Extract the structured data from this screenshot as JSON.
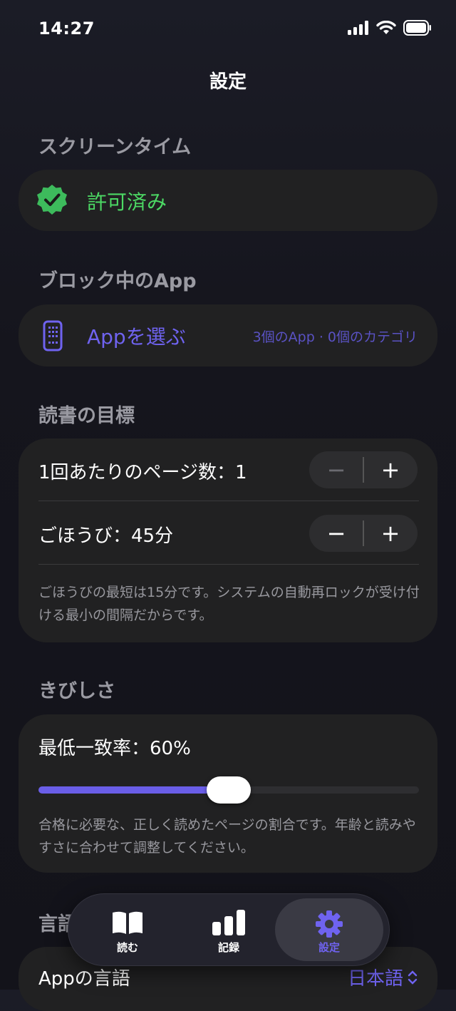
{
  "status": {
    "time": "14:27"
  },
  "header": {
    "title": "設定"
  },
  "screen_time": {
    "heading": "スクリーンタイム",
    "status": "許可済み",
    "status_color": "#4cd964"
  },
  "blocked": {
    "heading": "ブロック中のApp",
    "choose_label": "Appを選ぶ",
    "summary": "3個のApp · 0個のカテゴリ",
    "accent": "#6f63f0"
  },
  "goal": {
    "heading": "読書の目標",
    "pages_label": "1回あたりのページ数：1",
    "reward_label": "ごほうび：45分",
    "note": "ごほうびの最短は15分です。システムの自動再ロックが受け付ける最小の間隔だからです。",
    "minus": "−",
    "plus": "+"
  },
  "strictness": {
    "heading": "きびしさ",
    "label": "最低一致率：60%",
    "value_fraction": 0.5,
    "note": "合格に必要な、正しく読めたページの割合です。年齢と読みやすさに合わせて調整してください。"
  },
  "language": {
    "heading": "言語",
    "row_label": "Appの言語",
    "value": "日本語",
    "chevron": "⌃⌄"
  },
  "tabs": [
    {
      "label": "読む",
      "icon": "book-icon",
      "active": false
    },
    {
      "label": "記録",
      "icon": "chart-bars-icon",
      "active": false
    },
    {
      "label": "設定",
      "icon": "gear-icon",
      "active": true
    }
  ]
}
